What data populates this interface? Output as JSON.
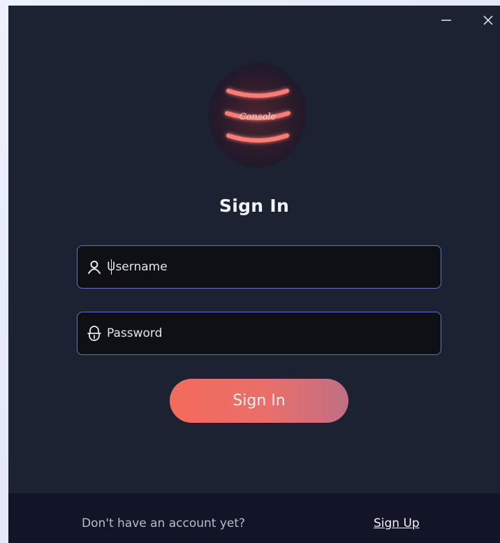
{
  "window": {
    "minimize_label": "−",
    "close_label": "✕"
  },
  "logo": {
    "script_text": "Console",
    "icon": "database-stack-icon"
  },
  "login": {
    "title": "Sign In",
    "username_placeholder": "Username",
    "username_value": "",
    "username_icon": "user-icon",
    "password_placeholder": "Password",
    "password_value": "",
    "password_icon": "lock-icon",
    "submit_label": "Sign In"
  },
  "footer": {
    "prompt": "Don't have an account yet?",
    "link_label": "Sign Up"
  },
  "colors": {
    "window_bg": "#1b2232",
    "footer_bg": "#111527",
    "field_border": "#5a77c6",
    "button_start": "#f36b5a",
    "button_end": "#bf6f85"
  }
}
